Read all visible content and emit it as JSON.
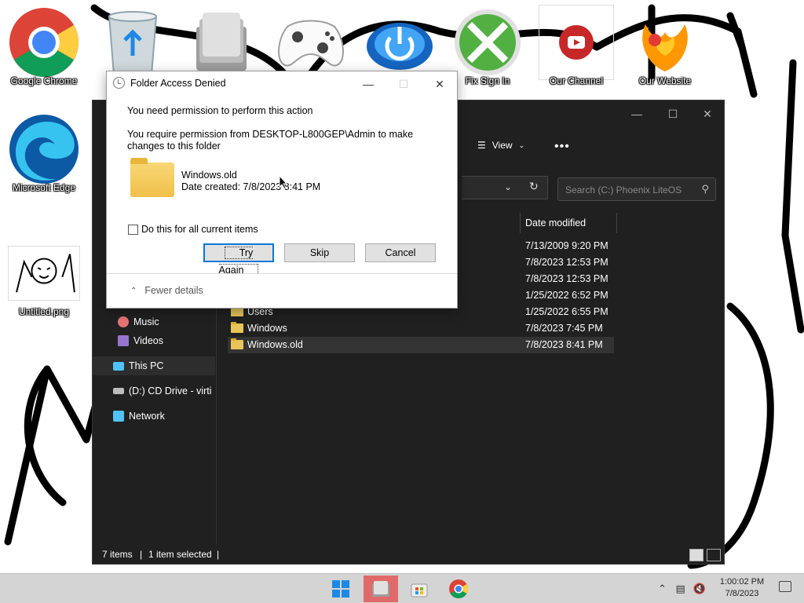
{
  "desktop": {
    "icons": [
      {
        "label": "Google Chrome",
        "icon": "chrome-icon"
      },
      {
        "label": "",
        "icon": "recycle-bin-icon"
      },
      {
        "label": "",
        "icon": "file-cabinet-icon"
      },
      {
        "label": "",
        "icon": "gamepad-icon"
      },
      {
        "label": "",
        "icon": "power-button-icon"
      },
      {
        "label": "Fix Sign In",
        "icon": "xbox-icon"
      },
      {
        "label": "Our Channel",
        "icon": "youtube-icon"
      },
      {
        "label": "Our Website",
        "icon": "phoenix-icon"
      },
      {
        "label": "Microsoft Edge",
        "icon": "edge-icon"
      },
      {
        "label": "Untitled.png",
        "icon": "drawing-thumbnail-icon"
      }
    ]
  },
  "explorer": {
    "view_label": "View",
    "more_label": "•••",
    "search_placeholder": "Search (C:) Phoenix LiteOS",
    "columns": {
      "date_modified": "Date modified"
    },
    "nav": [
      {
        "label": "Music",
        "icon": "music-icon"
      },
      {
        "label": "Videos",
        "icon": "videos-icon"
      },
      {
        "label": "This PC",
        "icon": "computer-icon"
      },
      {
        "label": "(D:) CD Drive - virti",
        "icon": "cd-drive-icon"
      },
      {
        "label": "Network",
        "icon": "network-icon"
      }
    ],
    "files": [
      {
        "name": "",
        "date": "7/13/2009 9:20 PM"
      },
      {
        "name": "",
        "date": "7/8/2023 12:53 PM"
      },
      {
        "name": "",
        "date": "7/8/2023 12:53 PM"
      },
      {
        "name": "",
        "date": "1/25/2022 6:52 PM"
      },
      {
        "name": "Users",
        "date": "1/25/2022 6:55 PM"
      },
      {
        "name": "Windows",
        "date": "7/8/2023 7:45 PM"
      },
      {
        "name": "Windows.old",
        "date": "7/8/2023 8:41 PM"
      }
    ],
    "status": {
      "items": "7 items",
      "selected": "1 item selected"
    }
  },
  "dialog": {
    "title": "Folder Access Denied",
    "heading": "You need permission to perform this action",
    "message": "You require permission from DESKTOP-L800GEP\\Admin to make changes to this folder",
    "folder_name": "Windows.old",
    "date_created": "Date created: 7/8/2023 8:41 PM",
    "checkbox_label": "Do this for all current items",
    "buttons": {
      "try_again": "Try Again",
      "skip": "Skip",
      "cancel": "Cancel"
    },
    "fewer_details": "Fewer details"
  },
  "taskbar": {
    "apps": [
      "start-icon",
      "file-explorer-icon",
      "store-icon",
      "chrome-icon"
    ],
    "time": "1:00:02 PM",
    "date": "7/8/2023"
  },
  "colors": {
    "explorer_bg": "#202020",
    "dialog_bg": "#ffffff",
    "accent": "#0078d7",
    "taskbar_bg": "#d4d4d4"
  }
}
